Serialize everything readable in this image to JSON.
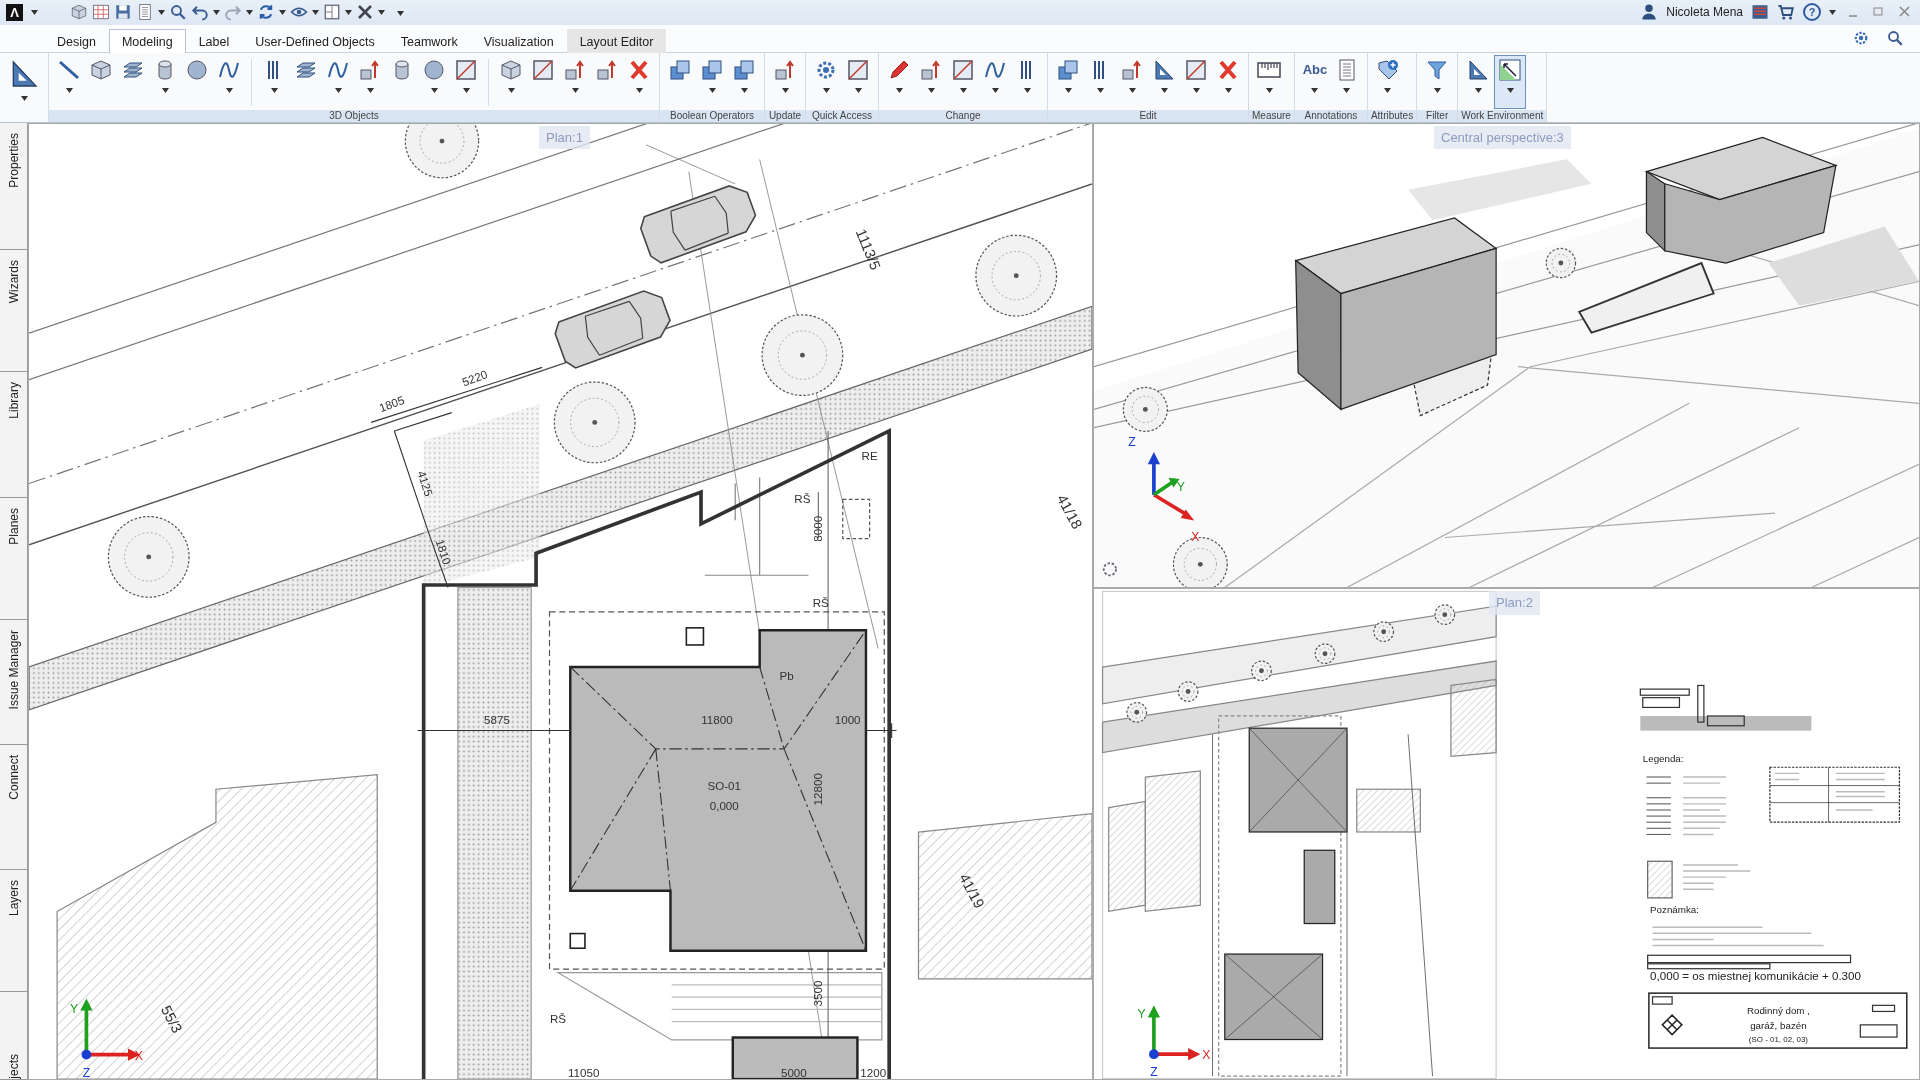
{
  "title_bar": {
    "logo": "Λ",
    "user": "Nicoleta Mena",
    "help": "?"
  },
  "tabs": [
    {
      "label": "Design",
      "selected": false,
      "contextual": false
    },
    {
      "label": "Modeling",
      "selected": true,
      "contextual": false
    },
    {
      "label": "Label",
      "selected": false,
      "contextual": false
    },
    {
      "label": "User-Defined Objects",
      "selected": false,
      "contextual": false
    },
    {
      "label": "Teamwork",
      "selected": false,
      "contextual": false
    },
    {
      "label": "Visualization",
      "selected": false,
      "contextual": false
    },
    {
      "label": "Layout Editor",
      "selected": false,
      "contextual": true
    }
  ],
  "ribbon_groups": [
    {
      "sections": [
        [
          {
            "dropdown": true,
            "selected": false
          }
        ]
      ]
    },
    {
      "label": "3D Objects",
      "sections": [
        [
          {
            "dropdown": true,
            "selected": false
          },
          {
            "dropdown": false,
            "selected": false
          },
          {
            "dropdown": false,
            "selected": false
          },
          {
            "dropdown": true,
            "selected": false
          },
          {
            "dropdown": false,
            "selected": false
          },
          {
            "dropdown": true,
            "selected": false
          }
        ],
        [
          {
            "dropdown": true,
            "selected": false
          },
          {
            "dropdown": false,
            "selected": false
          },
          {
            "dropdown": true,
            "selected": false
          },
          {
            "dropdown": true,
            "selected": false
          },
          {
            "dropdown": false,
            "selected": false
          },
          {
            "dropdown": true,
            "selected": false
          },
          {
            "dropdown": true,
            "selected": false
          }
        ],
        [
          {
            "dropdown": true,
            "selected": false
          },
          {
            "dropdown": false,
            "selected": false
          },
          {
            "dropdown": true,
            "selected": false
          },
          {
            "dropdown": false,
            "selected": false
          },
          {
            "dropdown": true,
            "selected": false
          }
        ]
      ]
    },
    {
      "label": "Boolean Operators",
      "sections": [
        [
          {
            "dropdown": false,
            "selected": false
          },
          {
            "dropdown": true,
            "selected": false
          },
          {
            "dropdown": true,
            "selected": false
          }
        ]
      ]
    },
    {
      "label": "Update",
      "sections": [
        [
          {
            "dropdown": true,
            "selected": false
          }
        ]
      ]
    },
    {
      "label": "Quick Access",
      "sections": [
        [
          {
            "dropdown": true,
            "selected": false
          },
          {
            "dropdown": true,
            "selected": false
          }
        ]
      ]
    },
    {
      "label": "Change",
      "sections": [
        [
          {
            "dropdown": true,
            "selected": false
          },
          {
            "dropdown": true,
            "selected": false
          },
          {
            "dropdown": true,
            "selected": false
          },
          {
            "dropdown": true,
            "selected": false
          },
          {
            "dropdown": true,
            "selected": false
          }
        ]
      ]
    },
    {
      "label": "Edit",
      "sections": [
        [
          {
            "dropdown": true,
            "selected": false
          },
          {
            "dropdown": true,
            "selected": false
          },
          {
            "dropdown": true,
            "selected": false
          },
          {
            "dropdown": true,
            "selected": false
          },
          {
            "dropdown": true,
            "selected": false
          },
          {
            "dropdown": true,
            "selected": false
          }
        ]
      ]
    },
    {
      "label": "Measure",
      "sections": [
        [
          {
            "dropdown": true,
            "selected": false
          }
        ]
      ]
    },
    {
      "label": "Annotations",
      "sections": [
        [
          {
            "label": "Abc",
            "dropdown": true,
            "selected": false
          },
          {
            "dropdown": true,
            "selected": false
          }
        ]
      ]
    },
    {
      "label": "Attributes",
      "sections": [
        [
          {
            "dropdown": true,
            "selected": false
          }
        ]
      ]
    },
    {
      "label": "Filter",
      "sections": [
        [
          {
            "dropdown": true,
            "selected": false
          }
        ]
      ]
    },
    {
      "label": "Work Environment",
      "sections": [
        [
          {
            "dropdown": true,
            "selected": false
          },
          {
            "dropdown": true,
            "selected": true
          }
        ]
      ]
    }
  ],
  "side_tabs": [
    {
      "label": "Properties"
    },
    {
      "label": "Wizards"
    },
    {
      "label": "Library"
    },
    {
      "label": "Planes"
    },
    {
      "label": "Issue Manager"
    },
    {
      "label": "Connect"
    },
    {
      "label": "Layers"
    },
    {
      "label": "jects"
    }
  ],
  "plan_view": {
    "label": "Plan:1",
    "texts": [
      "5220",
      "1805",
      "4125",
      "1810",
      "1113/5",
      "41/18",
      "RE",
      "RŠ",
      "8000",
      "RŠ",
      "Pb",
      "5875",
      "11800",
      "1000",
      "SO-01",
      "0,000",
      "12800",
      "41/19",
      "3500",
      "RŠ",
      "55/3",
      "11050",
      "5000",
      "1200"
    ],
    "axes": [
      "Y",
      "X",
      "Z"
    ]
  },
  "perspective_view": {
    "label": "Central perspective:3",
    "axes": [
      "Z",
      "Y",
      "X"
    ]
  },
  "layout_view": {
    "label": "Plan:2",
    "axes": [
      "Y",
      "X",
      "Z"
    ],
    "sheet_texts": [
      "Legenda:",
      "Poznámka:",
      "0,000 = os miestnej komunikácie + 0.300",
      "Rodinný dom ,",
      "garáž, bazén",
      "(SO - 01, 02, 03)"
    ]
  }
}
